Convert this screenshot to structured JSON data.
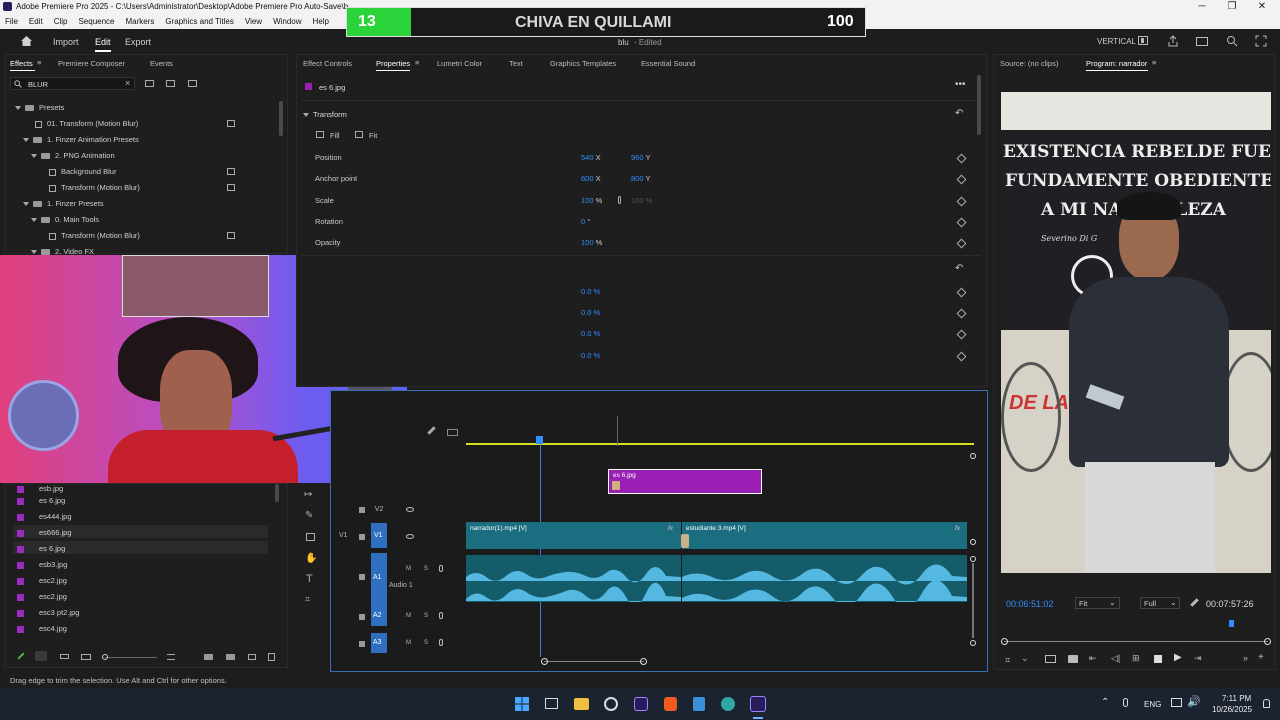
{
  "titlebar": {
    "title": "Adobe Premiere Pro 2025 - C:\\Users\\Administrator\\Desktop\\Adobe Premiere Pro Auto-Save\\b",
    "minimize": "─",
    "maximize": "❐",
    "close": "✕"
  },
  "menu": [
    "File",
    "Edit",
    "Clip",
    "Sequence",
    "Markers",
    "Graphics and Titles",
    "View",
    "Window",
    "Help"
  ],
  "overlay_banner": {
    "left_number": "13",
    "title": "CHIVA EN QUILLAMI",
    "right_number": "100"
  },
  "header": {
    "import": "Import",
    "edit": "Edit",
    "export": "Export",
    "project_name": "blu",
    "project_state": "- Edited",
    "workspace": "VERTICAL"
  },
  "effects_panel": {
    "tabs": [
      "Effects",
      "Premiere Composer",
      "Events"
    ],
    "search_value": "BLUR",
    "tree": [
      {
        "label": "Presets",
        "kind": "folder",
        "level": 0
      },
      {
        "label": "01. Transform (Motion Blur)",
        "kind": "fx",
        "level": 1
      },
      {
        "label": "1. Finzer Animation Presets",
        "kind": "folder",
        "level": 1
      },
      {
        "label": "2. PNG Animation",
        "kind": "folder",
        "level": 2
      },
      {
        "label": "Background Blur",
        "kind": "fx",
        "level": 3
      },
      {
        "label": "Transform (Motion Blur)",
        "kind": "fx",
        "level": 3
      },
      {
        "label": "1. Finzer Presets",
        "kind": "folder",
        "level": 1
      },
      {
        "label": "0. Main Tools",
        "kind": "folder",
        "level": 2
      },
      {
        "label": "Transform (Motion Blur)",
        "kind": "fx",
        "level": 3
      },
      {
        "label": "2. Video FX",
        "kind": "folder",
        "level": 2
      }
    ]
  },
  "project_files": [
    "esb.jpg",
    "es 6.jpg",
    "es444.jpg",
    "es666.jpg",
    "es 6.jpg",
    "esb3.jpg",
    "esc2.jpg",
    "esc2.jpg",
    "esc3 pt2.jpg",
    "esc4.jpg"
  ],
  "properties_panel": {
    "tabs": [
      "Effect Controls",
      "Properties",
      "Lumetri Color",
      "Text",
      "Graphics Templates",
      "Essential Sound"
    ],
    "active_tab": "Properties",
    "clip_name": "es 6.jpg",
    "section": "Transform",
    "fill_label": "Fill",
    "fit_label": "Fit",
    "rows": [
      {
        "label": "Position",
        "v1": "540",
        "u1": "X",
        "v2": "960",
        "u2": "Y"
      },
      {
        "label": "Anchor point",
        "v1": "600",
        "u1": "X",
        "v2": "800",
        "u2": "Y"
      },
      {
        "label": "Scale",
        "v1": "100",
        "u1": "%",
        "v2": "100 %",
        "u2": ""
      },
      {
        "label": "Rotation",
        "v1": "0",
        "u1": "°",
        "v2": "",
        "u2": ""
      },
      {
        "label": "Opacity",
        "v1": "100",
        "u1": "%",
        "v2": "",
        "u2": ""
      }
    ],
    "extra_values": [
      "0.0 %",
      "0.0 %",
      "0.0 %",
      "0.0 %"
    ]
  },
  "program_monitor": {
    "source_tab": "Source: (no clips)",
    "program_tab": "Program: narrador",
    "timecode_current": "00:06:51:02",
    "fit": "Fit",
    "quality": "Full",
    "timecode_total": "00:07:57:26",
    "poster_lines": [
      "EXISTENCIA REBELDE FUE",
      "FUNDAMENTE OBEDIENTE",
      "A MI NATURALEZA",
      "Severino Di G"
    ],
    "wall_text": "DE LA"
  },
  "timeline": {
    "tracks": {
      "v2": "V2",
      "v1": "V1",
      "a1": "A1",
      "a1_name": "Audio 1",
      "a2": "A2",
      "a3": "A3"
    },
    "clips": {
      "v3_clip": "es 6.jpg",
      "v1_clip_a": "narrador(1).mp4 [V]",
      "v1_clip_b": "estudiante 3.mp4 [V]"
    },
    "fx_badge": "fx"
  },
  "status_bar": "Drag edge to trim the selection. Use Alt and Ctrl for other options.",
  "taskbar": {
    "language": "ENG",
    "time": "7:11 PM",
    "date": "10/26/2025"
  },
  "colors": {
    "accent_blue": "#2f8fff",
    "clip_purple": "#9a1fb5",
    "clip_teal": "#1b6e80",
    "audio_wave": "#55b8e0",
    "banner_green": "#2bd33a"
  }
}
